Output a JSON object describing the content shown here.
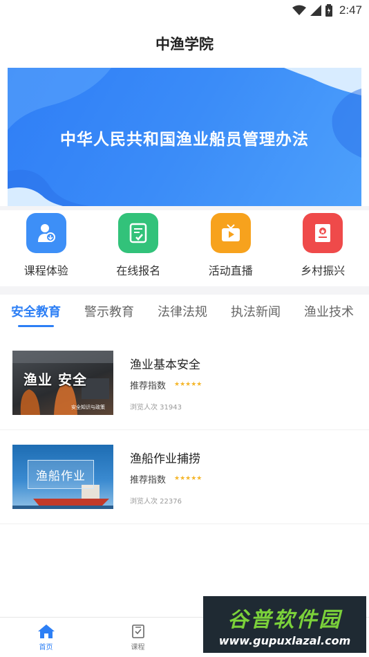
{
  "status_bar": {
    "time": "2:47"
  },
  "header": {
    "title": "中渔学院"
  },
  "banner": {
    "text": "中华人民共和国渔业船员管理办法"
  },
  "quick_menu": [
    {
      "label": "课程体验",
      "icon": "instructor-icon",
      "color": "#3d8ff7"
    },
    {
      "label": "在线报名",
      "icon": "checklist-icon",
      "color": "#32c27a"
    },
    {
      "label": "活动直播",
      "icon": "tv-play-icon",
      "color": "#f7a21d"
    },
    {
      "label": "乡村振兴",
      "icon": "book-star-icon",
      "color": "#ef4a4a"
    }
  ],
  "tabs": [
    {
      "label": "安全教育",
      "active": true
    },
    {
      "label": "警示教育",
      "active": false
    },
    {
      "label": "法律法规",
      "active": false
    },
    {
      "label": "执法新闻",
      "active": false
    },
    {
      "label": "渔业技术",
      "active": false
    }
  ],
  "courses": [
    {
      "title": "渔业基本安全",
      "rating_label": "推荐指数",
      "stars": "★★★★★",
      "views": "浏览人次 31943",
      "thumb_text": "渔业 安全",
      "thumb_sub": "安全知识与政策"
    },
    {
      "title": "渔船作业捕捞",
      "rating_label": "推荐指数",
      "stars": "★★★★★",
      "views": "浏览人次 22376",
      "thumb_text": "渔船作业"
    }
  ],
  "bottom_nav": [
    {
      "label": "首页",
      "icon": "home-icon",
      "active": true
    },
    {
      "label": "课程",
      "icon": "course-icon",
      "active": false
    }
  ],
  "watermark": {
    "cn": "谷普软件园",
    "url": "www.gupuxlazal.com"
  },
  "colors": {
    "accent": "#2d7ff5",
    "star": "#f5b62a"
  }
}
